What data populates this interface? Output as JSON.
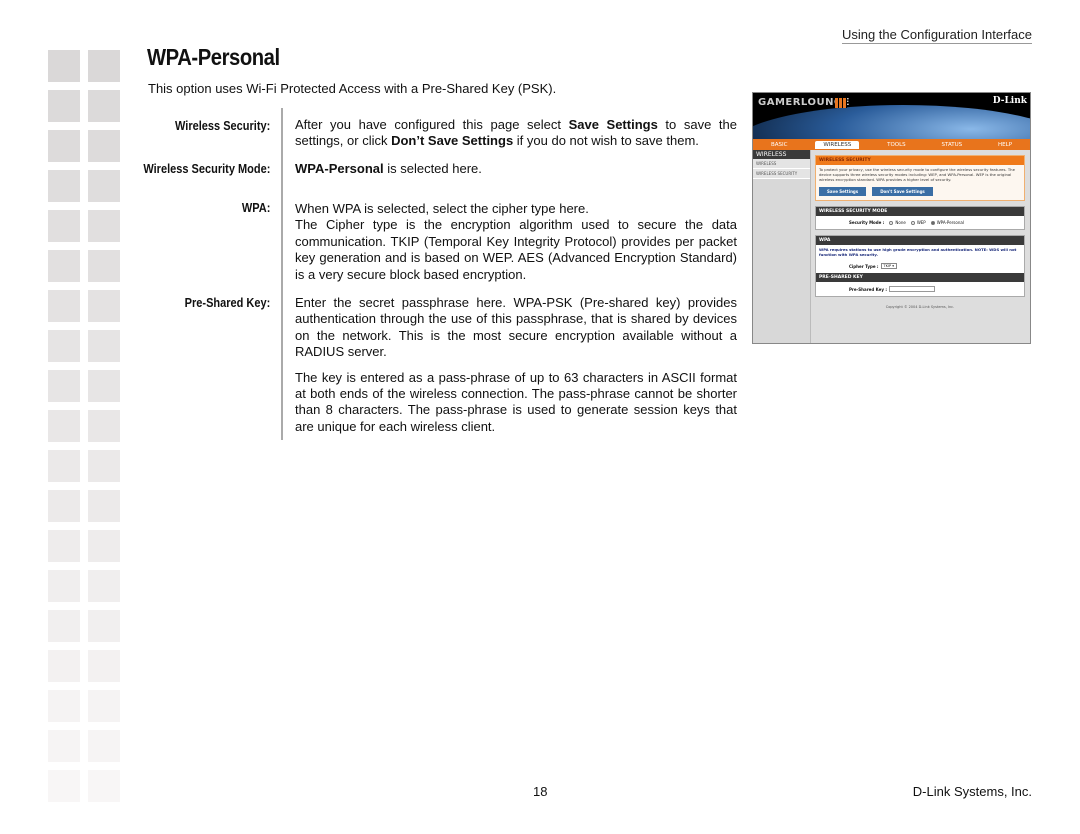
{
  "header": {
    "section": "Using the Configuration Interface"
  },
  "page": {
    "title": "WPA-Personal",
    "intro": "This option uses Wi-Fi Protected Access with a Pre-Shared Key (PSK)."
  },
  "entries": [
    {
      "label": "Wireless Security:",
      "text_parts": [
        "After you have configured this page select ",
        "Save Settings",
        " to save the settings, or click ",
        "Don’t Save Settings",
        " if you do not wish to save them."
      ]
    },
    {
      "label": "Wireless Security Mode:",
      "text_parts": [
        "WPA-Personal",
        " is selected here."
      ]
    },
    {
      "label": "WPA:",
      "text": "When WPA is selected, select the cipher type here.",
      "text2": "The Cipher type is the encryption algorithm used to secure the data communication. TKIP (Temporal Key Integrity Protocol) provides per packet key generation and is based on WEP. AES (Advanced Encryption Standard) is a very secure block based encryption."
    },
    {
      "label": "Pre-Shared Key:",
      "text": "Enter the secret passphrase here. WPA-PSK (Pre-shared key) provides authentication through the use of this passphrase, that is shared by devices on the network. This is the most secure encryption available without a RADIUS server.",
      "text2": "The key is entered as a pass-phrase of up to 63 characters in ASCII format at both ends of the wireless connection. The pass-phrase cannot be shorter than 8 characters. The pass-phrase is used to generate session keys that are unique for each wireless client."
    }
  ],
  "screenshot": {
    "brand": "GAMERLOUNGE",
    "vendor": "D-Link",
    "nav": [
      "BASIC",
      "WIRELESS",
      "TOOLS",
      "STATUS",
      "HELP"
    ],
    "active_nav": "WIRELESS",
    "sidebar": {
      "title": "WIRELESS",
      "items": [
        "WIRELESS",
        "WIRELESS SECURITY"
      ]
    },
    "wireless_security": {
      "heading": "WIRELESS SECURITY",
      "text": "To protect your privacy, use the wireless security mode to configure the wireless security features. The device supports three wireless security modes including: WEP, and WPA-Personal. WEP is the original wireless encryption standard. WPA provides a higher level of security.",
      "save_button": "Save Settings",
      "dont_save_button": "Don't Save Settings"
    },
    "security_mode": {
      "heading": "WIRELESS SECURITY MODE",
      "label": "Security Mode :",
      "options": [
        "None",
        "WEP",
        "WPA-Personal"
      ],
      "selected": "WPA-Personal"
    },
    "wpa": {
      "heading": "WPA",
      "text": "WPA requires stations to use high grade encryption and authentication. NOTE: WDS will not function with WPA security.",
      "cipher_label": "Cipher Type :",
      "cipher_value": "TKIP"
    },
    "psk": {
      "heading": "PRE-SHARED KEY",
      "label": "Pre-Shared Key :",
      "value": ""
    },
    "copyright": "Copyright © 2004 D-Link Systems, Inc."
  },
  "footer": {
    "page_number": "18",
    "company": "D-Link Systems, Inc."
  }
}
